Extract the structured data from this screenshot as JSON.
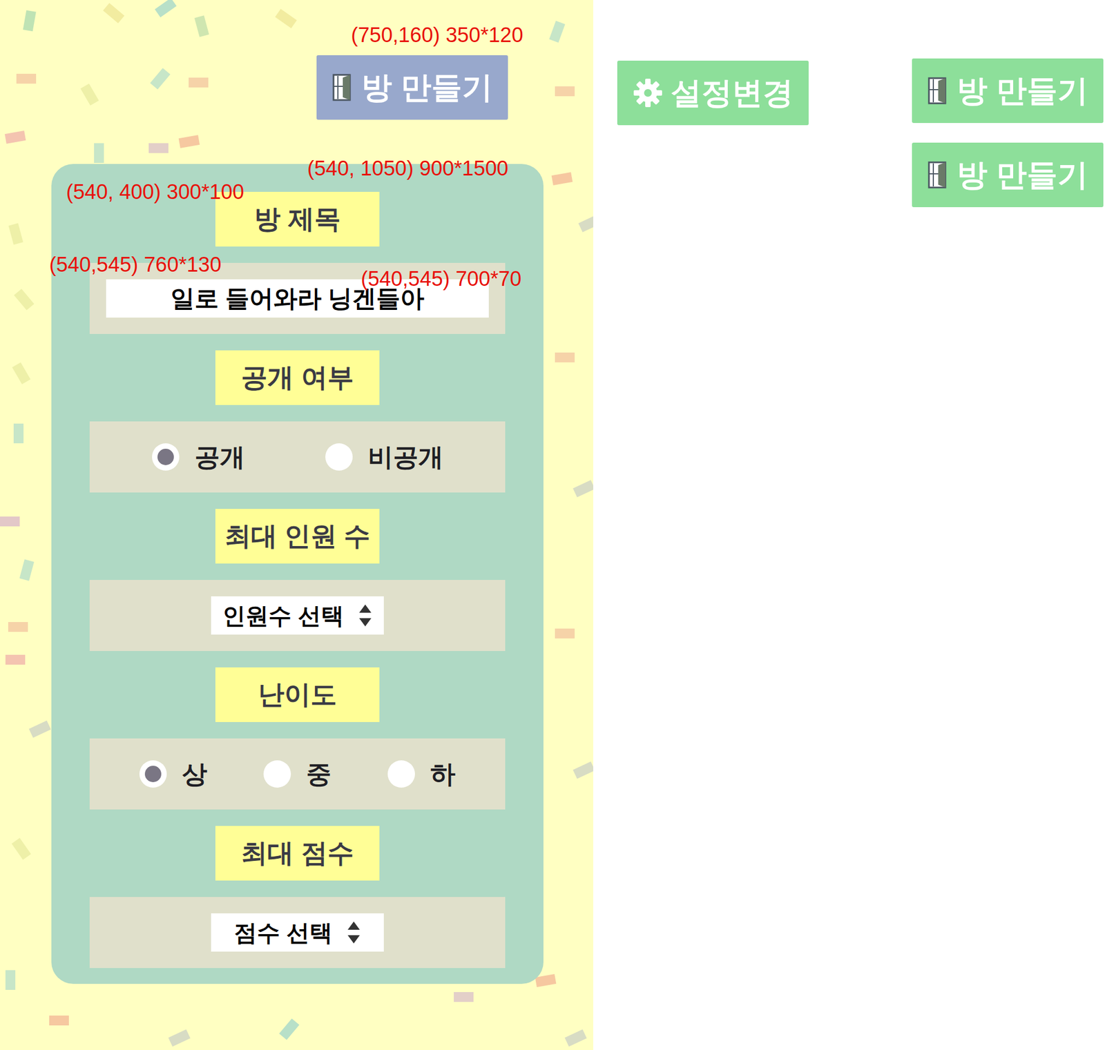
{
  "create_button": {
    "label": "방 만들기"
  },
  "side_buttons": [
    {
      "label": "설정변경",
      "kind": "settings"
    },
    {
      "label": "방 만들기",
      "kind": "room"
    },
    {
      "label": "방 만들기",
      "kind": "room"
    }
  ],
  "form": {
    "sections": [
      {
        "label": "방 제목",
        "kind": "text",
        "value": "일로 들어와라 닝겐들아"
      },
      {
        "label": "공개 여부",
        "kind": "radio",
        "options": [
          {
            "label": "공개",
            "selected": true
          },
          {
            "label": "비공개",
            "selected": false
          }
        ]
      },
      {
        "label": "최대 인원 수",
        "kind": "select",
        "value": "인원수 선택"
      },
      {
        "label": "난이도",
        "kind": "radio",
        "options": [
          {
            "label": "상",
            "selected": true
          },
          {
            "label": "중",
            "selected": false
          },
          {
            "label": "하",
            "selected": false
          }
        ]
      },
      {
        "label": "최대 점수",
        "kind": "select",
        "value": "점수 선택"
      }
    ]
  },
  "annotations": [
    {
      "text": "(750,160) 350*120"
    },
    {
      "text": "(540, 1050) 900*1500"
    },
    {
      "text": "(540, 400) 300*100"
    },
    {
      "text": "(540,545) 760*130"
    },
    {
      "text": "(540,545) 700*70"
    }
  ]
}
